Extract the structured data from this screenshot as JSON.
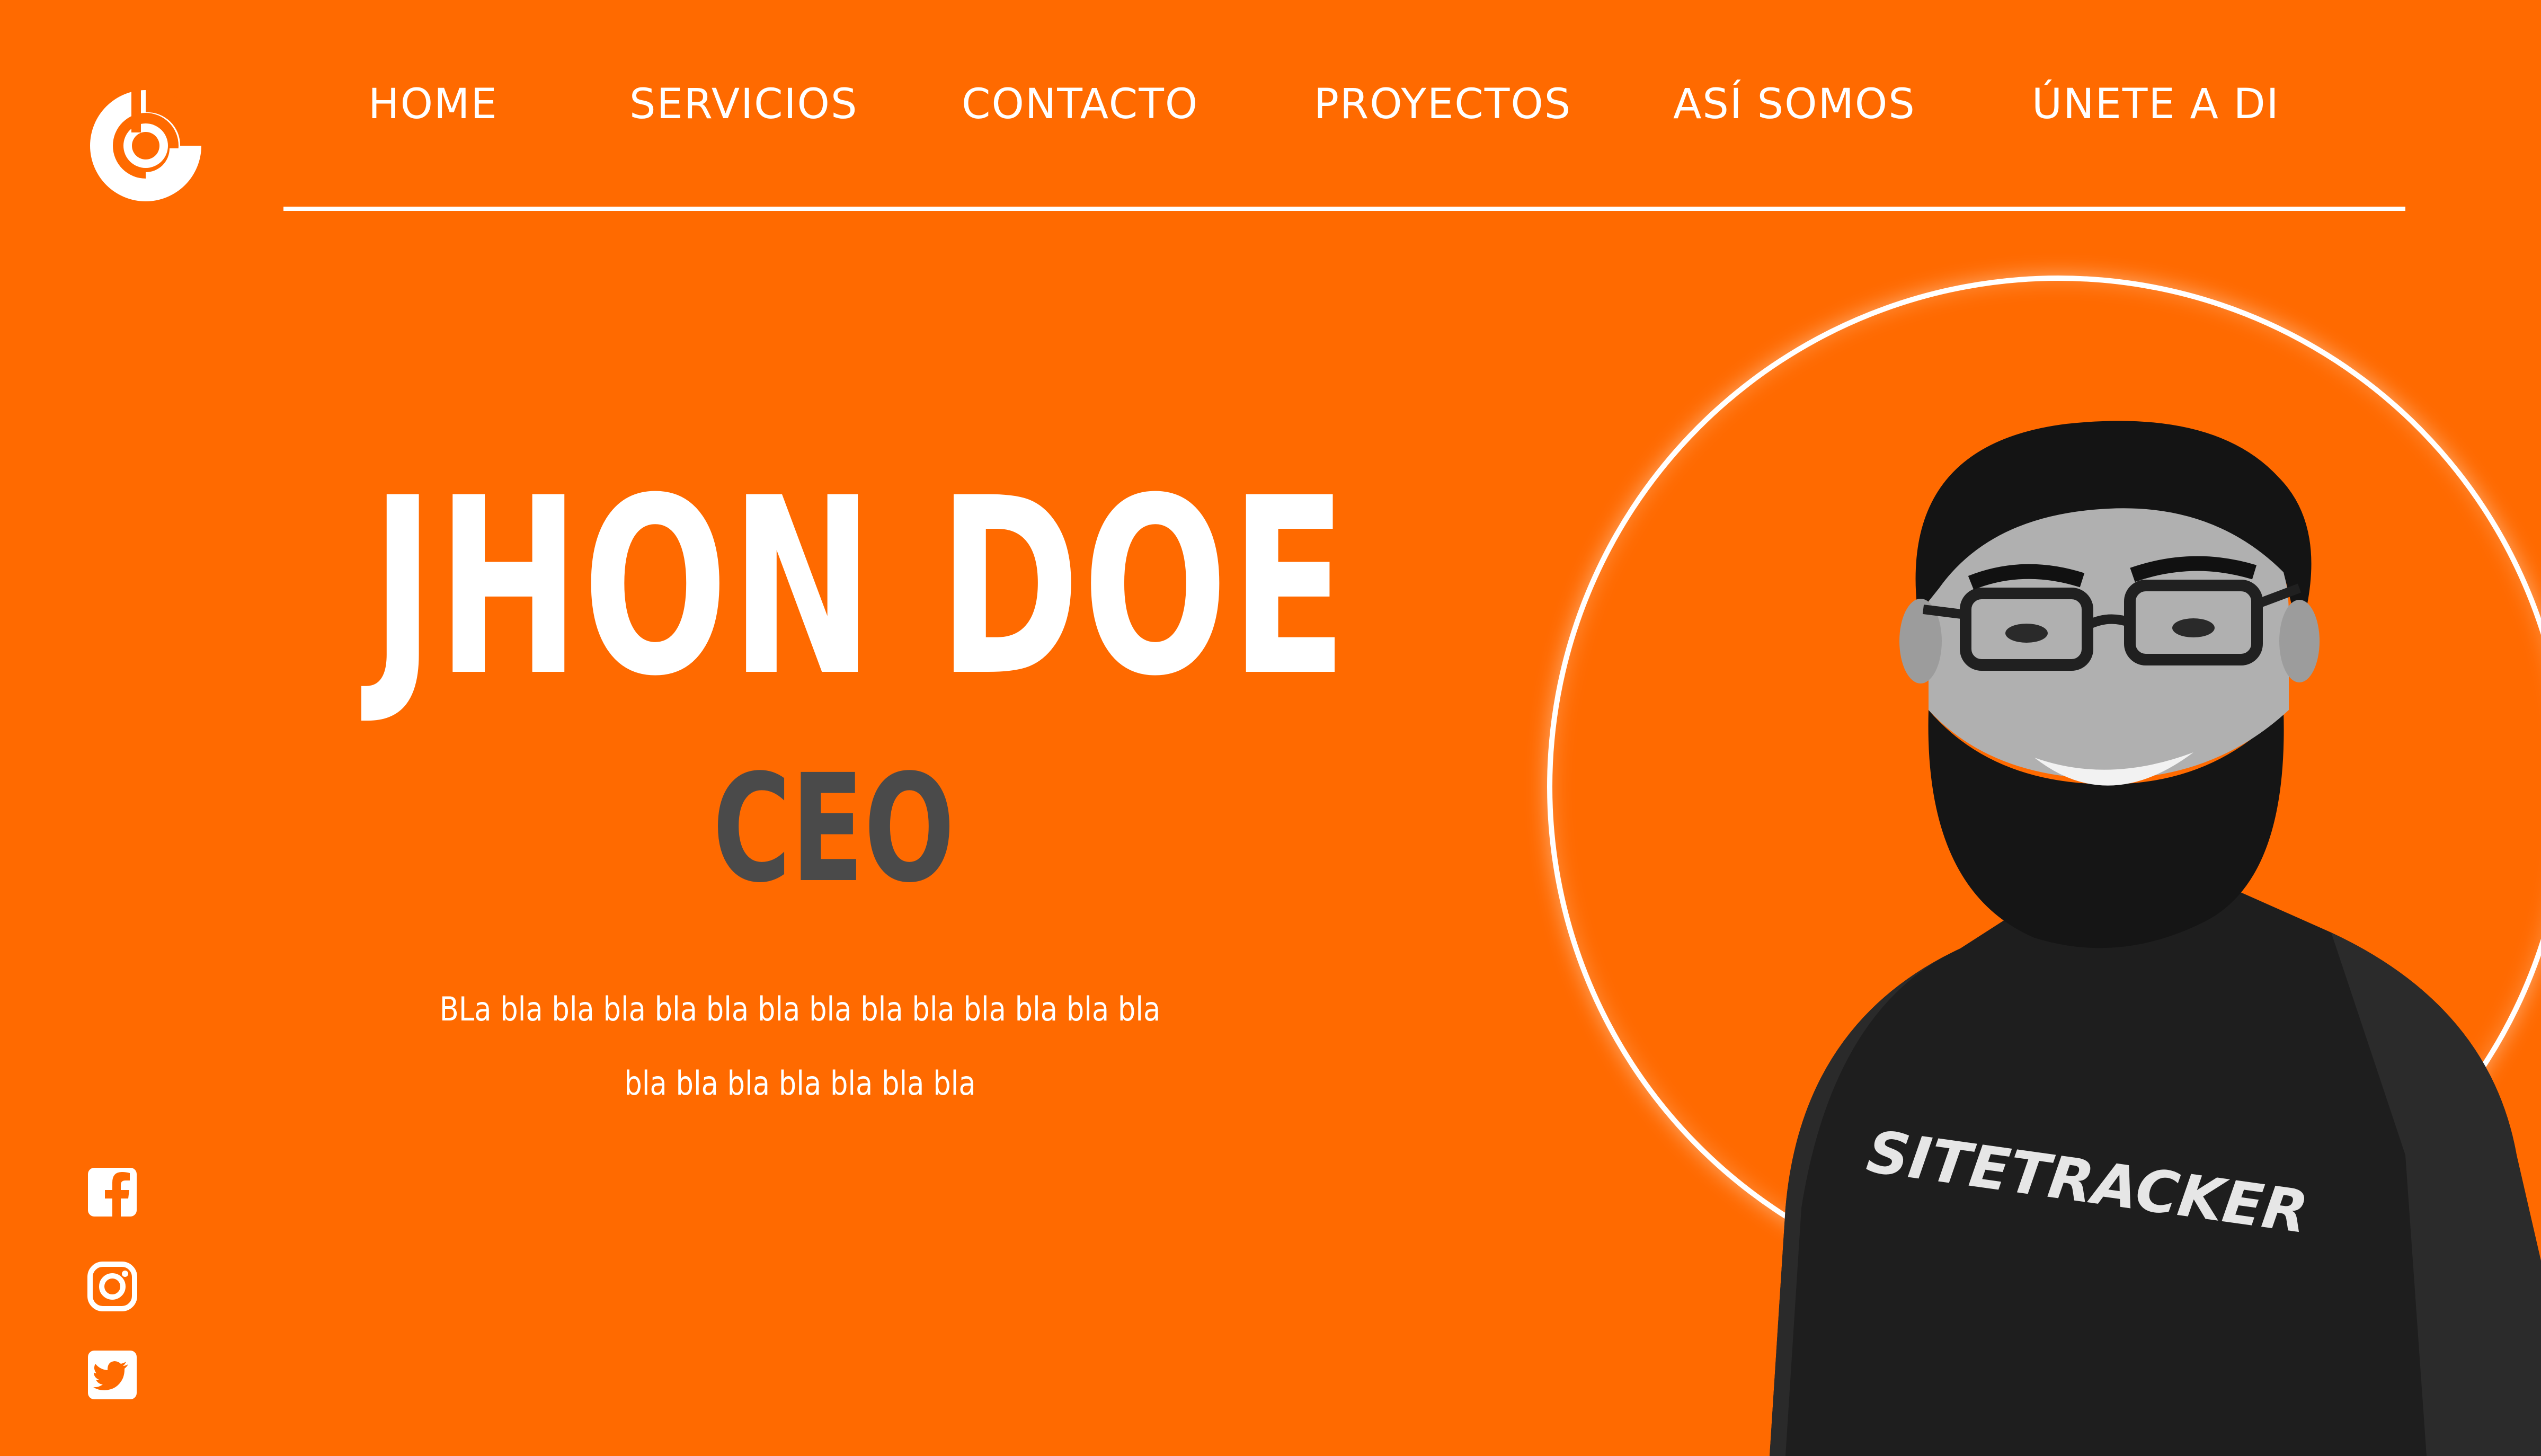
{
  "brand": {
    "logo_icon": "circular-swirl-logo-icon"
  },
  "nav": {
    "items": [
      {
        "label": "HOME"
      },
      {
        "label": "SERVICIOS"
      },
      {
        "label": "CONTACTO"
      },
      {
        "label": "PROYECTOS"
      },
      {
        "label": "ASÍ SOMOS"
      },
      {
        "label": "ÚNETE A DI"
      }
    ]
  },
  "hero": {
    "name": "JHON DOE",
    "role": "CEO",
    "description_line1": "BLa bla bla bla bla bla bla bla bla bla bla bla bla bla",
    "description_line2": "bla bla bla bla bla bla bla",
    "shirt_text": "SITETRACKER"
  },
  "social": {
    "icons": [
      "facebook-icon",
      "instagram-icon",
      "twitter-icon"
    ]
  },
  "colors": {
    "background": "#ff6a00",
    "primary_text": "#ffffff",
    "role_text": "#4a4a4a"
  }
}
